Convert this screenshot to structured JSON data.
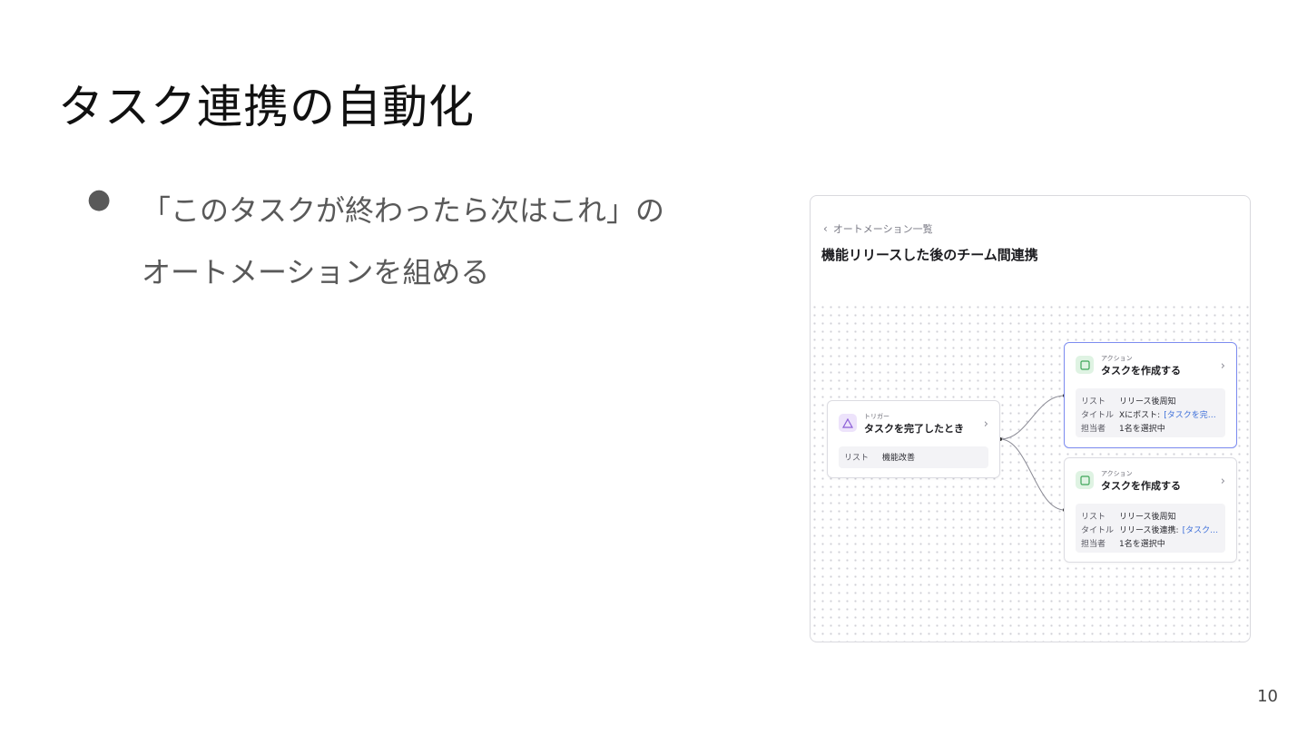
{
  "slide": {
    "title": "タスク連携の自動化",
    "bullet_line1": "「このタスクが終わったら次はこれ」の",
    "bullet_line2": "オートメーションを組める",
    "page_number": "10"
  },
  "screenshot": {
    "back_label": "オートメーション一覧",
    "flow_title": "機能リリースした後のチーム間連携",
    "trigger": {
      "kind": "トリガー",
      "label": "タスクを完了したとき",
      "rows": [
        {
          "key": "リスト",
          "value": "機能改善"
        }
      ]
    },
    "actions": [
      {
        "kind": "アクション",
        "label": "タスクを作成する",
        "rows": [
          {
            "key": "リスト",
            "value": "リリース後周知",
            "link": ""
          },
          {
            "key": "タイトル",
            "value": "Xにポスト:",
            "link": "[タスクを完…"
          },
          {
            "key": "担当者",
            "value": "1名を選択中",
            "link": ""
          }
        ]
      },
      {
        "kind": "アクション",
        "label": "タスクを作成する",
        "rows": [
          {
            "key": "リスト",
            "value": "リリース後周知",
            "link": ""
          },
          {
            "key": "タイトル",
            "value": "リリース後連携:",
            "link": "[タスク…"
          },
          {
            "key": "担当者",
            "value": "1名を選択中",
            "link": ""
          }
        ]
      }
    ]
  },
  "icons": {
    "bullet": "filled-circle",
    "back": "chevron-left-icon",
    "trigger": "triangle-icon",
    "action": "square-icon",
    "open": "chevron-right-icon"
  },
  "colors": {
    "selected_border": "#7d8cf0",
    "link": "#3d6fd9",
    "trigger_icon_bg": "#ede3fb",
    "action_icon_bg": "#dff3e3"
  }
}
